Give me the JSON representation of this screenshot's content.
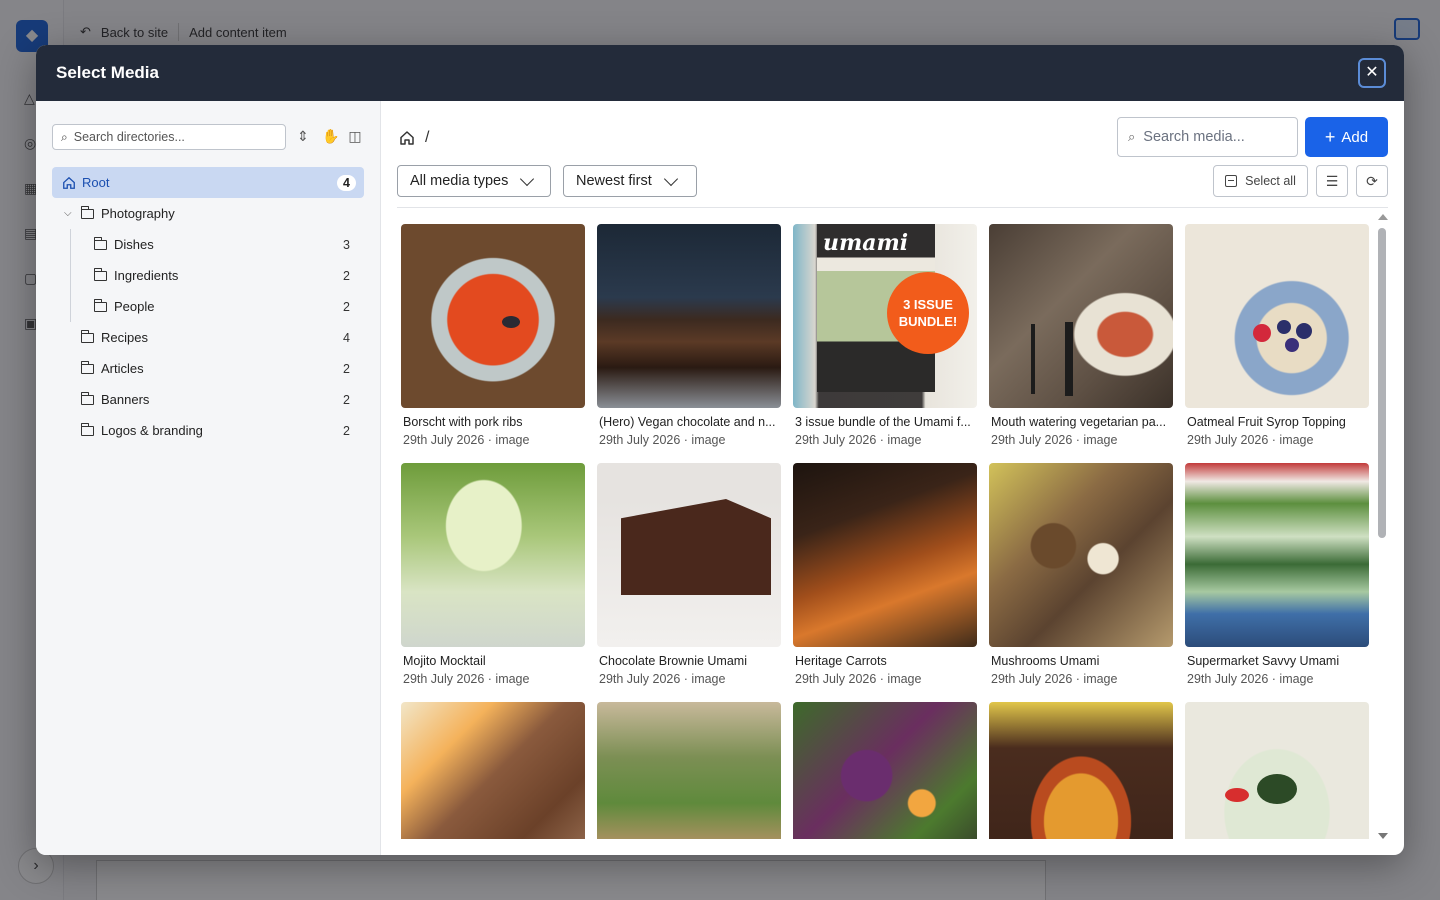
{
  "background": {
    "back_label": "Back to site",
    "breadcrumb_label": "Add content item"
  },
  "modal": {
    "title": "Select Media",
    "close_glyph": "✕"
  },
  "directories": {
    "search_placeholder": "Search directories...",
    "items": [
      {
        "label": "Root",
        "count": "4",
        "icon": "home-icon",
        "level": 0,
        "active": true
      },
      {
        "label": "Photography",
        "count": "",
        "icon": "folder-icon",
        "level": 1,
        "expanded": true
      },
      {
        "label": "Dishes",
        "count": "3",
        "icon": "folder-icon",
        "level": 2
      },
      {
        "label": "Ingredients",
        "count": "2",
        "icon": "folder-icon",
        "level": 2
      },
      {
        "label": "People",
        "count": "2",
        "icon": "folder-icon",
        "level": 2
      },
      {
        "label": "Recipes",
        "count": "4",
        "icon": "folder-icon",
        "level": 1
      },
      {
        "label": "Articles",
        "count": "2",
        "icon": "folder-icon",
        "level": 1
      },
      {
        "label": "Banners",
        "count": "2",
        "icon": "folder-icon",
        "level": 1
      },
      {
        "label": "Logos & branding",
        "count": "2",
        "icon": "folder-icon",
        "level": 1
      }
    ]
  },
  "toolbar": {
    "breadcrumb_sep": "/",
    "search_placeholder": "Search media...",
    "add_label": "Add",
    "type_filter": "All media types",
    "sort": "Newest first",
    "select_all_label": "Select all"
  },
  "media": [
    {
      "title": "Borscht with pork ribs",
      "meta": "29th July 2026 · image",
      "thumb": "t-borscht"
    },
    {
      "title": "(Hero) Vegan chocolate and n...",
      "meta": "29th July 2026 · image",
      "thumb": "t-brownie"
    },
    {
      "title": "3 issue bundle of the Umami f...",
      "meta": "29th July 2026 · image",
      "thumb": "t-umami",
      "art_text": "umami",
      "badge": "3 ISSUE BUNDLE!"
    },
    {
      "title": "Mouth watering vegetarian pa...",
      "meta": "29th July 2026 · image",
      "thumb": "t-pasta"
    },
    {
      "title": "Oatmeal Fruit Syrop Topping",
      "meta": "29th July 2026 · image",
      "thumb": "t-oatmeal"
    },
    {
      "title": "Mojito Mocktail",
      "meta": "29th July 2026 · image",
      "thumb": "t-mojito"
    },
    {
      "title": "Chocolate Brownie Umami",
      "meta": "29th July 2026 · image",
      "thumb": "t-choc-brownie"
    },
    {
      "title": "Heritage Carrots",
      "meta": "29th July 2026 · image",
      "thumb": "t-carrots"
    },
    {
      "title": "Mushrooms Umami",
      "meta": "29th July 2026 · image",
      "thumb": "t-mushrooms"
    },
    {
      "title": "Supermarket Savvy Umami",
      "meta": "29th July 2026 · image",
      "thumb": "t-supermarket"
    },
    {
      "title": "",
      "meta": "",
      "thumb": "t-chocolate"
    },
    {
      "title": "",
      "meta": "",
      "thumb": "t-herbs"
    },
    {
      "title": "",
      "meta": "",
      "thumb": "t-salad"
    },
    {
      "title": "",
      "meta": "",
      "thumb": "t-bake"
    },
    {
      "title": "",
      "meta": "",
      "thumb": "t-soup"
    }
  ],
  "colors": {
    "header_bg": "#232b3a",
    "accent": "#1a63e8",
    "active_item_bg": "#c9d8f2"
  }
}
